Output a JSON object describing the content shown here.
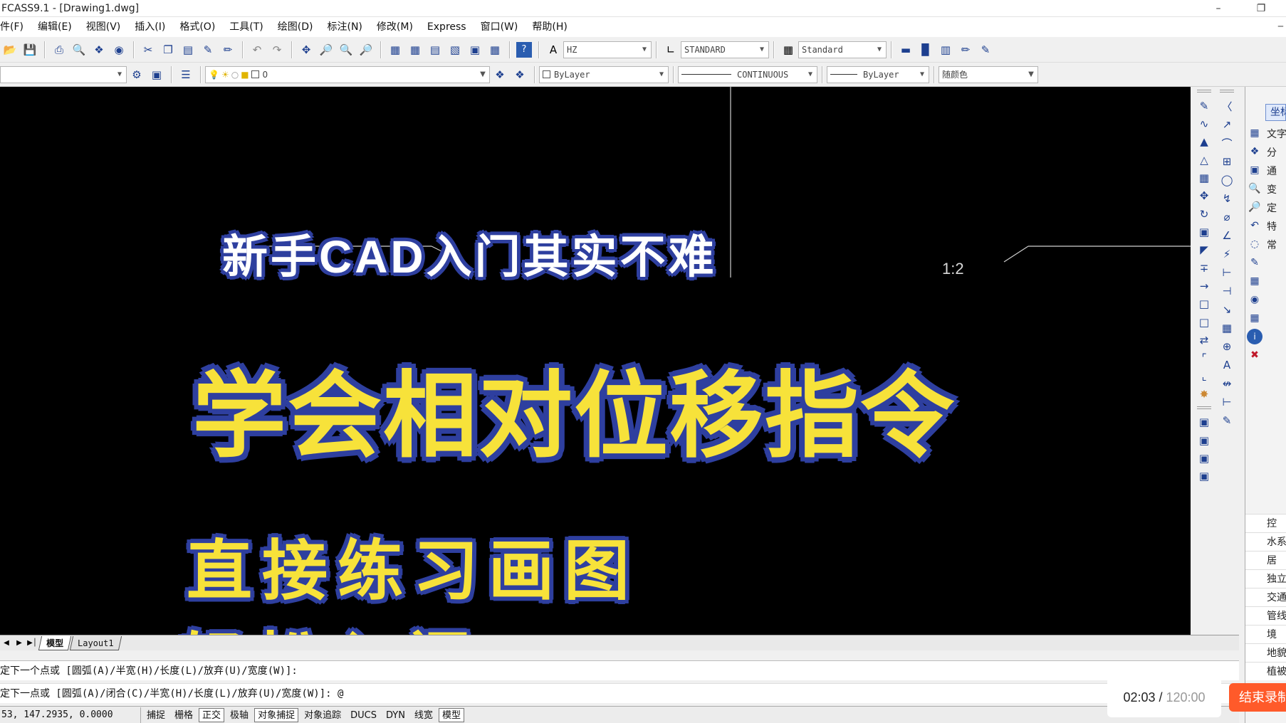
{
  "window": {
    "title": "FCASS9.1 - [Drawing1.dwg]",
    "minimize": "–",
    "restore": "❐"
  },
  "menu": [
    "件(F)",
    "编辑(E)",
    "视图(V)",
    "插入(I)",
    "格式(O)",
    "工具(T)",
    "绘图(D)",
    "标注(N)",
    "修改(M)",
    "Express",
    "窗口(W)",
    "帮助(H)"
  ],
  "toolbar1": {
    "text_style": "HZ",
    "dim_style": "STANDARD",
    "table_style": "Standard"
  },
  "toolbar2": {
    "layer": "0",
    "color": "ByLayer",
    "linetype": "CONTINUOUS",
    "lineweight": "ByLayer",
    "plotstyle": "随颜色"
  },
  "drawing": {
    "scale_labels": [
      "1:2",
      "1:2"
    ]
  },
  "captions": {
    "line1": "新手CAD入门其实不难",
    "line2": "学会相对位移指令",
    "line3": "直接练习画图",
    "line4": "轻松入门"
  },
  "layout_tabs": {
    "model": "模型",
    "layout1": "Layout1"
  },
  "command": {
    "line1": "定下一个点或 [圆弧(A)/半宽(H)/长度(L)/放弃(U)/宽度(W)]:",
    "line2": "定下一点或 [圆弧(A)/闭合(C)/半宽(H)/长度(L)/放弃(U)/宽度(W)]: @"
  },
  "status": {
    "coords": "53, 147.2935, 0.0000",
    "buttons": [
      {
        "label": "捕捉",
        "on": false
      },
      {
        "label": "栅格",
        "on": false
      },
      {
        "label": "正交",
        "on": true
      },
      {
        "label": "极轴",
        "on": false
      },
      {
        "label": "对象捕捉",
        "on": true
      },
      {
        "label": "对象追踪",
        "on": false
      },
      {
        "label": "DUCS",
        "on": false
      },
      {
        "label": "DYN",
        "on": false
      },
      {
        "label": "线宽",
        "on": false
      },
      {
        "label": "模型",
        "on": true
      }
    ]
  },
  "right_panel": {
    "header": "坐标",
    "items_top": [
      "文字",
      "分",
      "通",
      "变",
      "定",
      "特",
      "常"
    ],
    "items_bottom": [
      "控",
      "水系",
      "居",
      "独立",
      "交通",
      "管线",
      "境",
      "地貌",
      "植被"
    ]
  },
  "recording": {
    "elapsed": "02:03",
    "total": "120:00",
    "separator": " / ",
    "stop_label": "结束录制"
  },
  "colors": {
    "canvas_bg": "#000000",
    "caption_yellow": "#f7e23a",
    "caption_outline": "#2e3f9f",
    "caption_white": "#ffffff",
    "stop_button": "#ff5a2a"
  }
}
